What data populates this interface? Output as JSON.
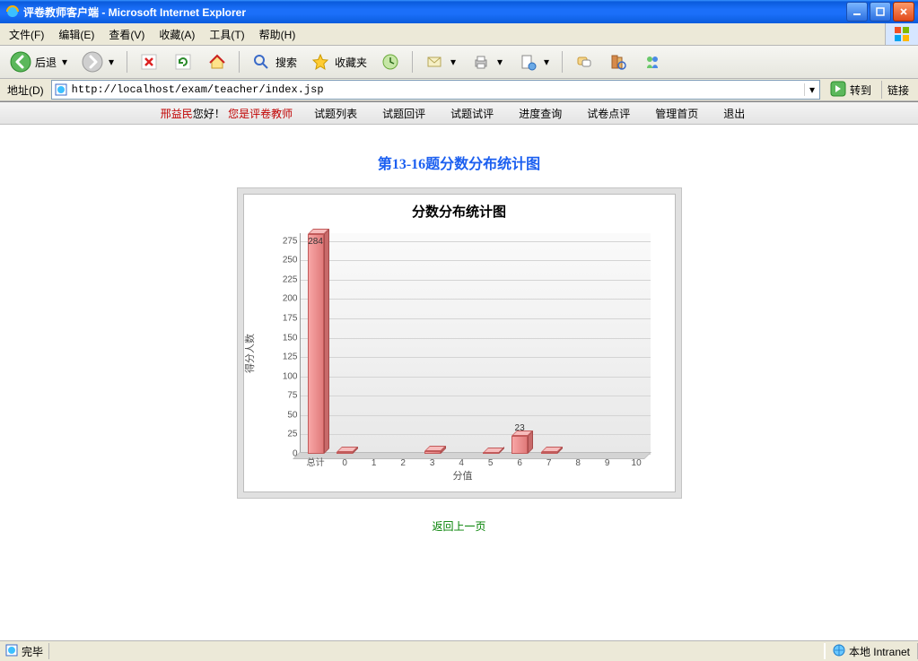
{
  "window": {
    "title": "评卷教师客户端 - Microsoft Internet Explorer"
  },
  "menubar": {
    "items": [
      "文件(F)",
      "编辑(E)",
      "查看(V)",
      "收藏(A)",
      "工具(T)",
      "帮助(H)"
    ]
  },
  "toolbar": {
    "back": "后退",
    "search": "搜索",
    "favorites": "收藏夹"
  },
  "addressbar": {
    "label": "地址(D)",
    "url": "http://localhost/exam/teacher/index.jsp",
    "go": "转到",
    "links": "链接"
  },
  "nav": {
    "username": "邢益民",
    "greet": "您好！",
    "role": "您是评卷教师",
    "items": [
      "试题列表",
      "试题回评",
      "试题试评",
      "进度查询",
      "试卷点评",
      "管理首页",
      "退出"
    ]
  },
  "page": {
    "title": "第13-16题分数分布统计图",
    "backlink": "返回上一页"
  },
  "chart_data": {
    "type": "bar",
    "title": "分数分布统计图",
    "xlabel": "分值",
    "ylabel": "得分人数",
    "ylim": [
      0,
      285
    ],
    "yticks": [
      0,
      25,
      50,
      75,
      100,
      125,
      150,
      175,
      200,
      225,
      250,
      275
    ],
    "categories": [
      "总计",
      "0",
      "1",
      "2",
      "3",
      "4",
      "5",
      "6",
      "7",
      "8",
      "9",
      "10"
    ],
    "values": [
      284,
      2,
      0,
      0,
      4,
      0,
      1,
      23,
      2,
      0,
      0,
      0
    ],
    "value_labels": [
      "284",
      "",
      "",
      "",
      "",
      "",
      "",
      "23",
      "",
      "",
      "",
      ""
    ]
  },
  "statusbar": {
    "done": "完毕",
    "zone": "本地 Intranet"
  }
}
